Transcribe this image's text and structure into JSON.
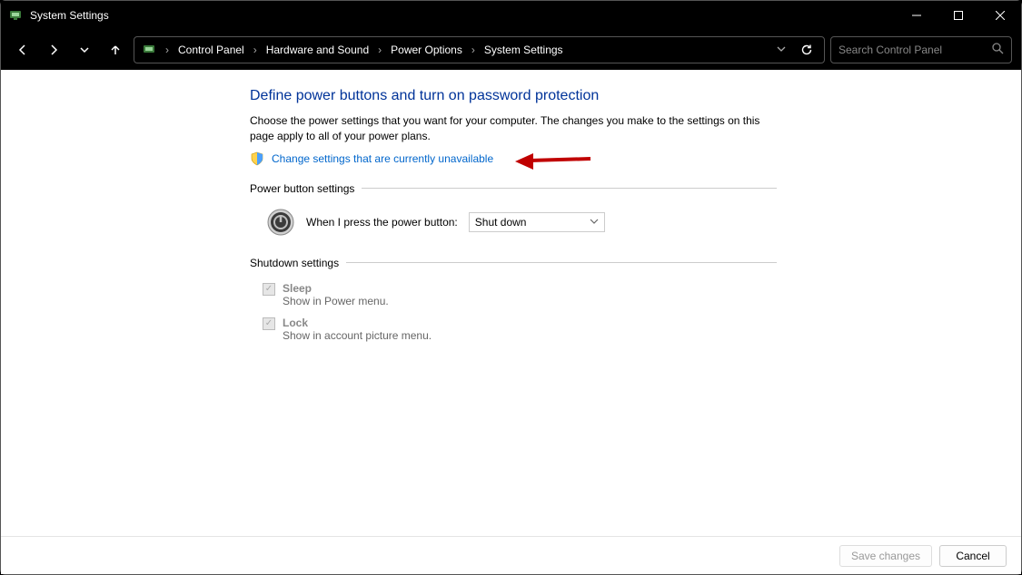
{
  "window": {
    "title": "System Settings"
  },
  "breadcrumb": {
    "items": [
      "Control Panel",
      "Hardware and Sound",
      "Power Options",
      "System Settings"
    ]
  },
  "search": {
    "placeholder": "Search Control Panel"
  },
  "page": {
    "heading": "Define power buttons and turn on password protection",
    "description": "Choose the power settings that you want for your computer. The changes you make to the settings on this page apply to all of your power plans.",
    "link": "Change settings that are currently unavailable",
    "section_power": "Power button settings",
    "power_label": "When I press the power button:",
    "power_value": "Shut down",
    "section_shutdown": "Shutdown settings",
    "checks": [
      {
        "title": "Sleep",
        "sub": "Show in Power menu."
      },
      {
        "title": "Lock",
        "sub": "Show in account picture menu."
      }
    ]
  },
  "footer": {
    "save": "Save changes",
    "cancel": "Cancel"
  }
}
